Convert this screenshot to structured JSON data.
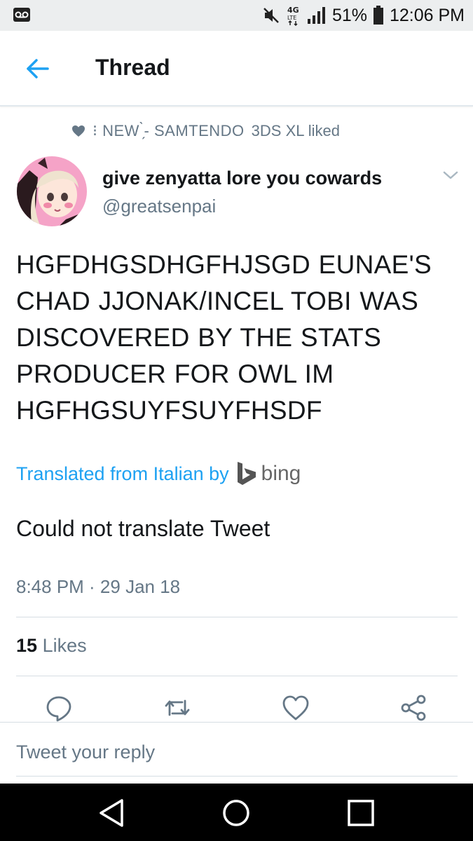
{
  "status_bar": {
    "network": "4G LTE",
    "battery": "51%",
    "time": "12:06 PM"
  },
  "header": {
    "title": "Thread"
  },
  "social_context": {
    "liked_by": "⁝ NEW ̗̀- SAMTENDO",
    "suffix": "3DS XL liked"
  },
  "tweet": {
    "display_name": "give zenyatta lore you cowards",
    "handle": "@greatsenpai",
    "text": "HGFDHGSDHGFHJSGD EUNAE'S CHAD JJONAK/INCEL TOBI WAS DISCOVERED BY THE STATS PRODUCER FOR OWL IM HGFHGSUYFSUYFHSDF",
    "translated_label": "Translated from Italian by",
    "translator": "bing",
    "translation_result": "Could not translate Tweet",
    "timestamp": "8:48 PM · 29 Jan 18",
    "likes_count": "15",
    "likes_label": "Likes"
  },
  "reply": {
    "placeholder": "Tweet your reply"
  },
  "colors": {
    "accent": "#1da1f2",
    "secondary_text": "#657786",
    "primary_text": "#14171a",
    "divider": "#e1e8ed"
  },
  "icons": {
    "back": "arrow-left-icon",
    "like_context": "heart-icon",
    "menu": "chevron-down-icon",
    "reply": "reply-icon",
    "retweet": "retweet-icon",
    "like": "heart-outline-icon",
    "share": "share-icon",
    "nav_back": "triangle-back-icon",
    "nav_home": "circle-home-icon",
    "nav_recents": "square-recents-icon"
  }
}
